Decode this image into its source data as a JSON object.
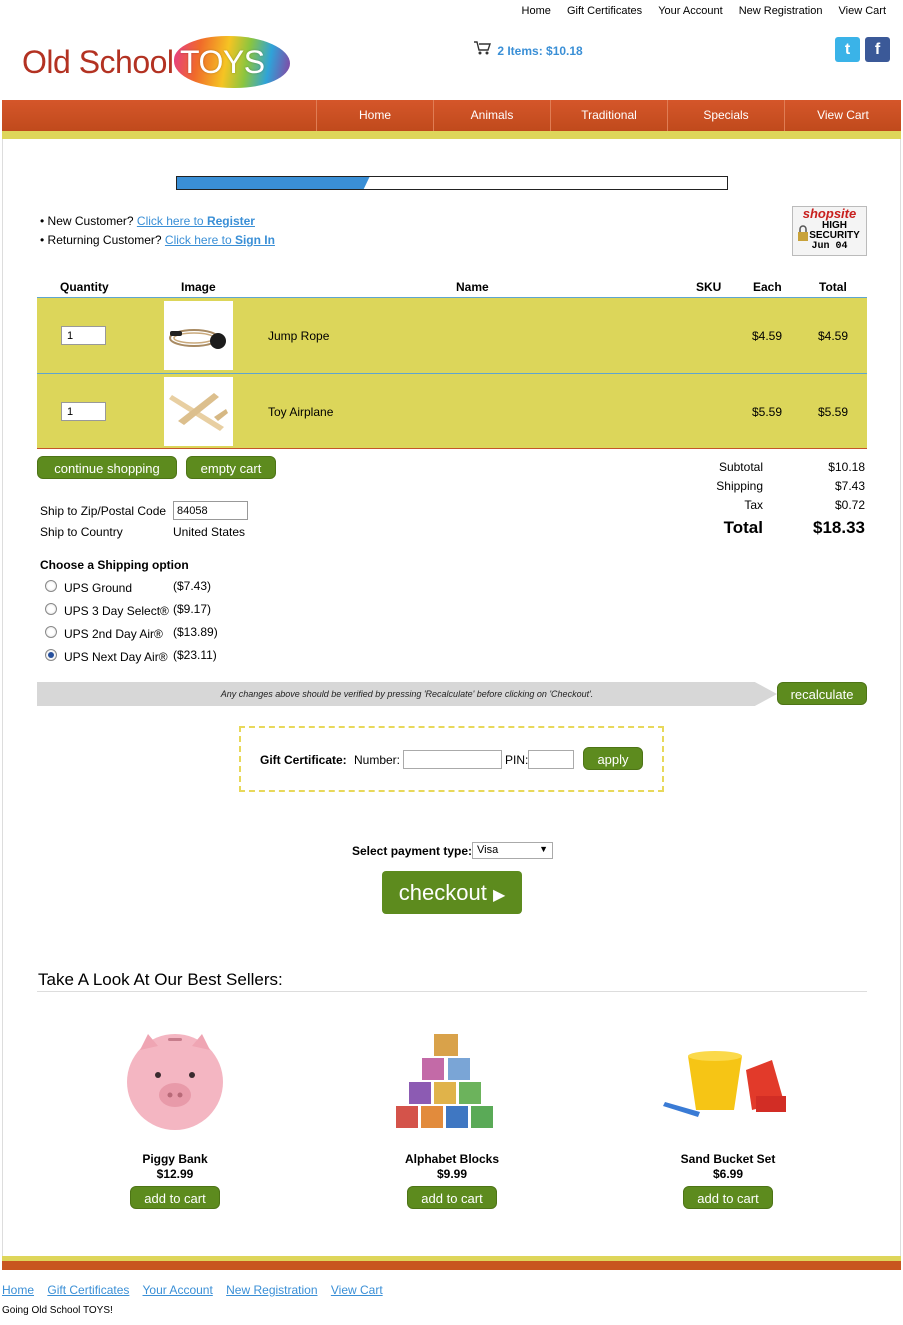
{
  "top_links": [
    "Home",
    "Gift Certificates",
    "Your Account",
    "New Registration",
    "View Cart"
  ],
  "logo": {
    "part1": "Old School",
    "part2": "TOYS"
  },
  "cart_summary": "2 Items: $10.18",
  "nav": [
    "Home",
    "Animals",
    "Traditional",
    "Specials",
    "View Cart"
  ],
  "progress": 0.35,
  "customer": {
    "new_prefix": "• New Customer? ",
    "new_link1": "Click here to ",
    "new_link2": "Register",
    "returning_prefix": "• Returning Customer? ",
    "returning_link1": "Click here to ",
    "returning_link2": "Sign In"
  },
  "badge": {
    "brand": "shopsite",
    "line1": "HIGH",
    "line2": "SECURITY",
    "date": "Jun 04"
  },
  "table": {
    "headers": [
      "Quantity",
      "Image",
      "Name",
      "SKU",
      "Each",
      "Total"
    ],
    "rows": [
      {
        "qty": "1",
        "name": "Jump Rope",
        "sku": "",
        "each": "$4.59",
        "total": "$4.59"
      },
      {
        "qty": "1",
        "name": "Toy Airplane",
        "sku": "",
        "each": "$5.59",
        "total": "$5.59"
      }
    ]
  },
  "buttons": {
    "continue": "continue shopping",
    "empty": "empty cart",
    "recalculate": "recalculate",
    "apply": "apply",
    "checkout": "checkout"
  },
  "totals": {
    "subtotal_label": "Subtotal",
    "subtotal": "$10.18",
    "shipping_label": "Shipping",
    "shipping": "$7.43",
    "tax_label": "Tax",
    "tax": "$0.72",
    "total_label": "Total",
    "total": "$18.33"
  },
  "ship": {
    "zip_label": "Ship to Zip/Postal Code",
    "zip": "84058",
    "country_label": "Ship to Country",
    "country": "United States"
  },
  "shipping_options": {
    "title": "Choose a Shipping option",
    "options": [
      {
        "label": "UPS Ground",
        "price": "($7.43)",
        "selected": false
      },
      {
        "label": "UPS 3 Day Select®",
        "price": "($9.17)",
        "selected": false
      },
      {
        "label": "UPS 2nd Day Air®",
        "price": "($13.89)",
        "selected": false
      },
      {
        "label": "UPS Next Day Air®",
        "price": "($23.11)",
        "selected": true
      }
    ]
  },
  "notice": "Any changes above should be verified by pressing 'Recalculate' before clicking on 'Checkout'.",
  "gift": {
    "label": "Gift Certificate:",
    "number_label": "Number:",
    "pin_label": "PIN:"
  },
  "payment": {
    "label": "Select payment type:",
    "selected": "Visa"
  },
  "bestsellers": {
    "title": "Take A Look At Our Best Sellers:",
    "add_label": "add to cart",
    "products": [
      {
        "name": "Piggy Bank",
        "price": "$12.99"
      },
      {
        "name": "Alphabet Blocks",
        "price": "$9.99"
      },
      {
        "name": "Sand Bucket Set",
        "price": "$6.99"
      }
    ]
  },
  "footer": {
    "links": [
      "Home",
      "Gift Certificates",
      "Your Account",
      "New Registration",
      "View Cart"
    ],
    "tagline": "Going Old School TOYS!"
  },
  "colors": {
    "accent_blue": "#3a8fd6",
    "nav_orange": "#c8561f",
    "row_yellow": "#dcd65a",
    "button_green": "#5d8b1e"
  }
}
